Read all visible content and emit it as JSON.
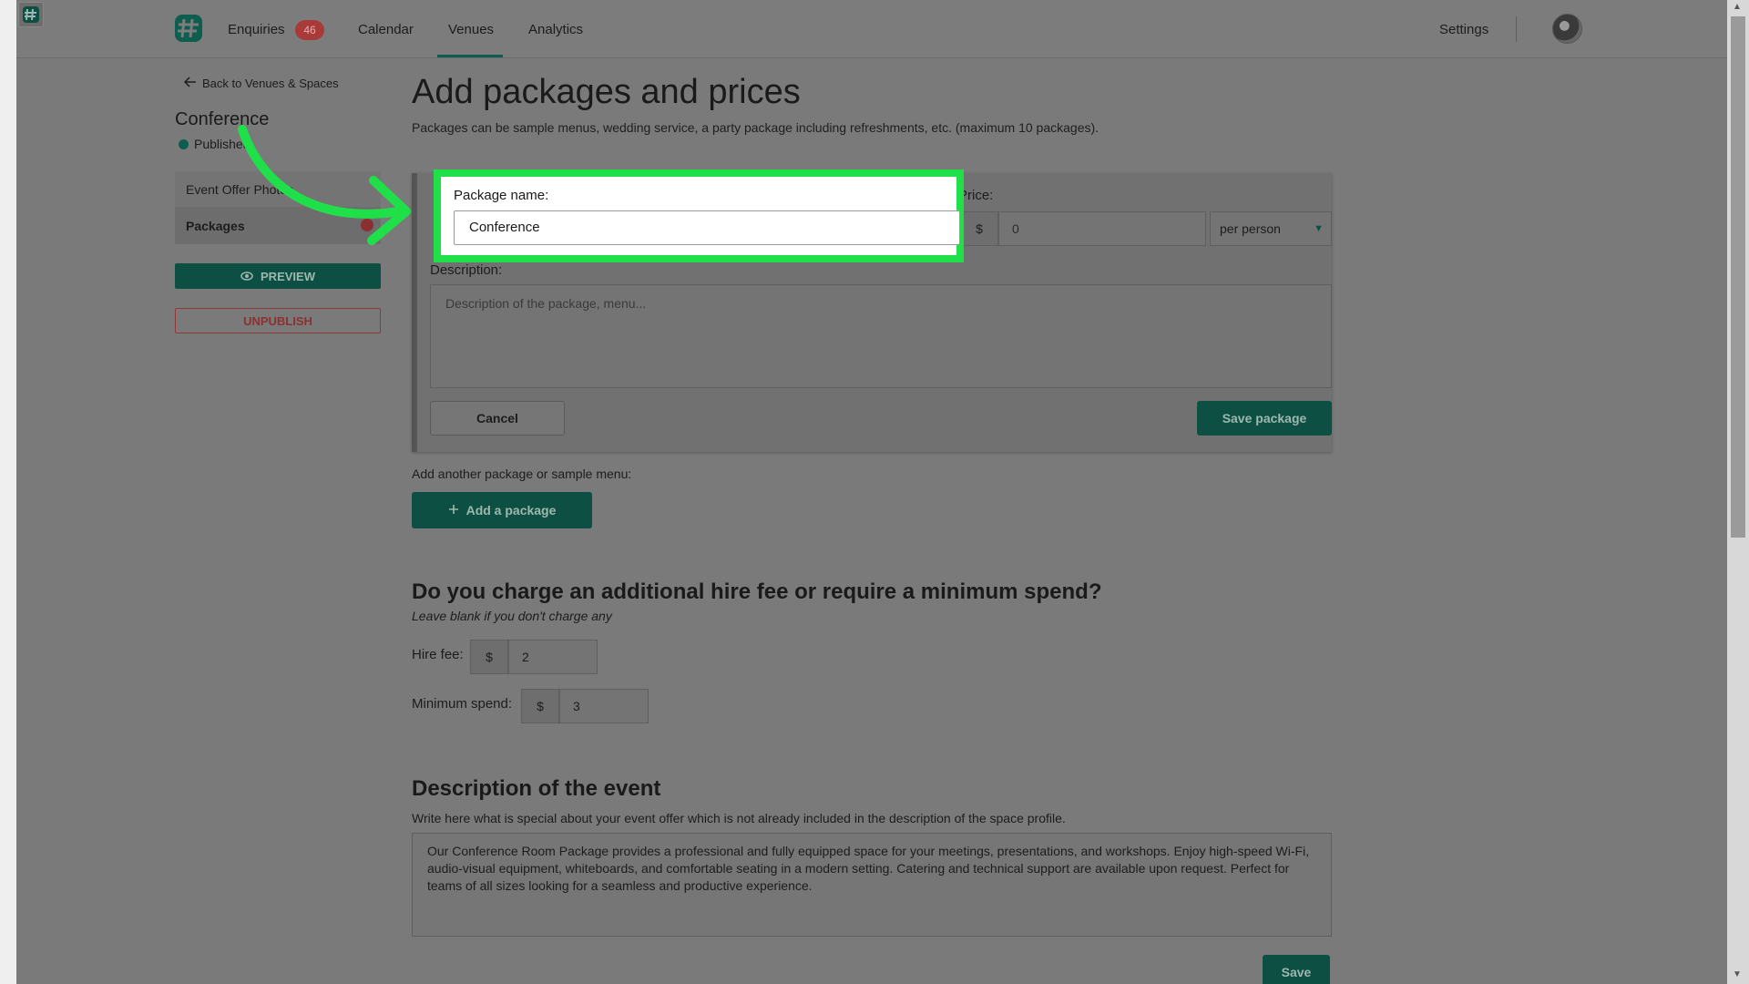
{
  "nav": {
    "enquiries": "Enquiries",
    "enquiries_badge": "46",
    "calendar": "Calendar",
    "venues": "Venues",
    "analytics": "Analytics",
    "settings": "Settings"
  },
  "sidebar": {
    "back_link": "Back to Venues & Spaces",
    "venue_name": "Conference",
    "status": "Published",
    "items": [
      {
        "label": "Event Offer Photos"
      },
      {
        "label": "Packages"
      }
    ],
    "preview_label": "PREVIEW",
    "unpublish_label": "UNPUBLISH"
  },
  "main": {
    "title": "Add packages and prices",
    "subtitle": "Packages can be sample menus, wedding service, a party package including refreshments, etc. (maximum 10 packages)."
  },
  "package_form": {
    "name_label": "Package name:",
    "name_value": "Conference",
    "price_label": "Price:",
    "price_currency": "$",
    "price_value": "0",
    "price_unit": "per person",
    "description_label": "Description:",
    "description_placeholder": "Description of the package, menu...",
    "cancel_label": "Cancel",
    "save_label": "Save package"
  },
  "add_package": {
    "label": "Add another package or sample menu:",
    "button_label": "Add a package"
  },
  "hire": {
    "title": "Do you charge an additional hire fee or require a minimum spend?",
    "hint": "Leave blank if you don't charge any",
    "hire_fee_label": "Hire fee:",
    "hire_fee_currency": "$",
    "hire_fee_value": "2",
    "min_spend_label": "Minimum spend:",
    "min_spend_currency": "$",
    "min_spend_value": "3"
  },
  "event_description": {
    "title": "Description of the event",
    "hint": "Write here what is special about your event offer which is not already included in the description of the space profile.",
    "text": "Our Conference Room Package provides a professional and fully equipped space for your meetings, presentations, and workshops. Enjoy high-speed Wi-Fi, audio-visual equipment, whiteboards, and comfortable seating in a modern setting. Catering and technical support are available upon request. Perfect for teams of all sizes looking for a seamless and productive experience.",
    "save_label": "Save"
  },
  "colors": {
    "brand": "#0e4f43",
    "highlight": "#20e04a",
    "badge": "#a83a3a"
  }
}
